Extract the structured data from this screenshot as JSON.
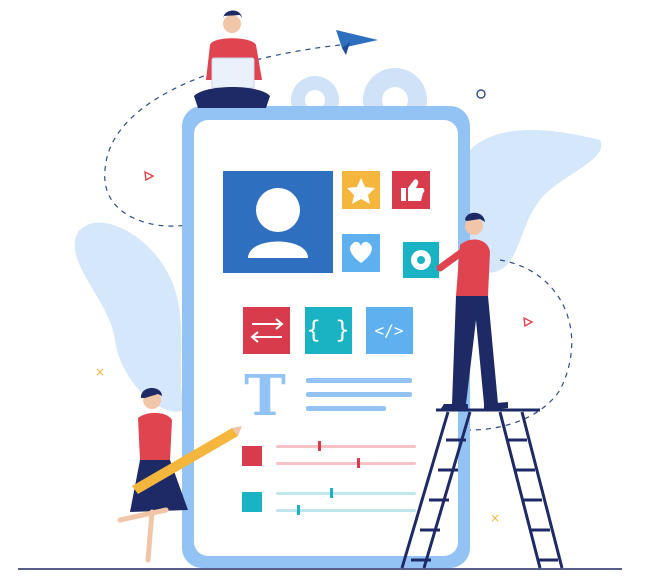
{
  "illustration": {
    "app_mockup_glyph": "T",
    "icons": [
      "user-profile-icon",
      "star-icon",
      "thumbs-up-icon",
      "heart-icon",
      "gear-icon",
      "swap-arrows-icon",
      "curly-braces-icon",
      "code-tag-icon",
      "paper-plane-icon"
    ],
    "people": [
      "man-sitting-with-laptop",
      "man-standing-on-ladder",
      "woman-holding-pencil"
    ],
    "colors": {
      "phone_frame": "#93c3f5",
      "phone_screen": "#ffffff",
      "profile_tile": "#2f6fc0",
      "star_tile": "#f4b63c",
      "thumbs_tile": "#d83b4b",
      "heart_tile": "#5fb0ee",
      "gear_tile": "#19b3c4",
      "swap_tile": "#d83b4b",
      "braces_tile": "#19b3c4",
      "code_tile": "#5fb0ee",
      "navy": "#1e2a66",
      "shirt_red": "#e0454f",
      "blob_light_blue": "#d4e7fb",
      "cog_grey_blue": "#cfe2f7"
    }
  }
}
